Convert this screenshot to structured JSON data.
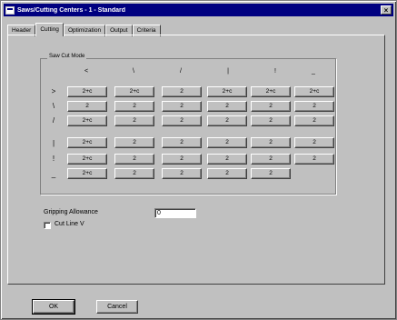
{
  "window": {
    "title": "Saws/Cutting Centers - 1 - Standard",
    "close_glyph": "×"
  },
  "tabs": [
    {
      "label": "Header",
      "active": false
    },
    {
      "label": "Cutting",
      "active": true
    },
    {
      "label": "Optimization",
      "active": false
    },
    {
      "label": "Output",
      "active": false
    },
    {
      "label": "Criteria",
      "active": false
    }
  ],
  "group": {
    "label": "Saw Cut Mode",
    "columns": [
      "<",
      "\\",
      "/",
      "|",
      "!",
      "_"
    ],
    "rows": [
      {
        "header": ">",
        "cells": [
          "2+c",
          "2+c",
          "2",
          "2+c",
          "2+c",
          "2+c"
        ]
      },
      {
        "header": "\\",
        "cells": [
          "2",
          "2",
          "2",
          "2",
          "2",
          "2"
        ]
      },
      {
        "header": "/",
        "cells": [
          "2+c",
          "2",
          "2",
          "2",
          "2",
          "2"
        ]
      },
      {
        "header": "|",
        "cells": [
          "2+c",
          "2",
          "2",
          "2",
          "2",
          "2"
        ]
      },
      {
        "header": "!",
        "cells": [
          "2+c",
          "2",
          "2",
          "2",
          "2",
          "2"
        ]
      },
      {
        "header": "_",
        "cells": [
          "2+c",
          "2",
          "2",
          "2",
          "2"
        ]
      }
    ]
  },
  "gripping": {
    "label": "Gripping Allowance",
    "value": "0"
  },
  "checkbox": {
    "label": "Cut Line V",
    "checked": false
  },
  "buttons": {
    "ok": "OK",
    "cancel": "Cancel"
  }
}
